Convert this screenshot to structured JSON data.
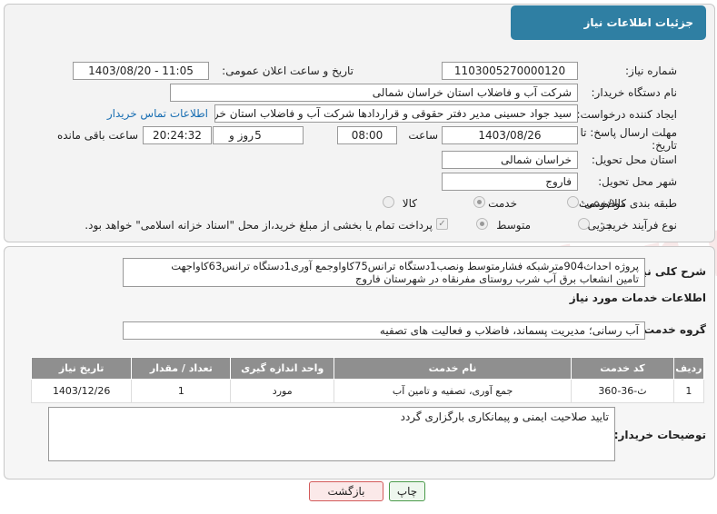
{
  "header": {
    "title": "جزئیات اطلاعات نیاز"
  },
  "form": {
    "need_number_label": "شماره نیاز:",
    "need_number": "1103005270000120",
    "announce_label": "تاریخ و ساعت اعلان عمومی:",
    "announce_value": "1403/08/20 - 11:05",
    "buyer_org_label": "نام دستگاه خریدار:",
    "buyer_org": "شرکت آب و فاضلاب استان خراسان شمالی",
    "creator_label": "ایجاد کننده درخواست:",
    "creator": "سید جواد حسینی مدیر دفتر حقوقی و قراردادها  شرکت آب و فاضلاب استان خراسان شمالی",
    "contact_link": "اطلاعات تماس خریدار",
    "deadline_label_1": "مهلت ارسال پاسخ: تا",
    "deadline_label_2": "تاریخ:",
    "deadline_date": "1403/08/26",
    "time_label": "ساعت",
    "deadline_time": "08:00",
    "days_value": "5",
    "days_label": "روز و",
    "remaining_time": "20:24:32",
    "remaining_label": "ساعت باقی مانده",
    "province_label": "استان محل تحویل:",
    "province": "خراسان شمالی",
    "city_label": "شهر محل تحویل:",
    "city": "فاروج",
    "category_label": "طبقه بندی موضوعی:",
    "category_options": [
      "کالا",
      "خدمت",
      "کالا/خدمت"
    ],
    "category_selected": "خدمت",
    "process_label": "نوع فرآیند خرید :",
    "process_options": [
      "جزیی",
      "متوسط"
    ],
    "process_selected": "متوسط",
    "payment_note": "پرداخت تمام یا بخشی از مبلغ خرید،از محل \"اسناد خزانه اسلامی\" خواهد بود."
  },
  "description": {
    "label": "شرح کلی نیاز:",
    "text_line1": "پروژه احداث904مترشبکه فشارمتوسط ونصب1دستگاه ترانس75کاواوجمع آوری1دستگاه ترانس63کاواجهت",
    "text_line2": "تامین انشعاب برق آب شرب روستای مفرنقاه در شهرستان فاروج"
  },
  "services": {
    "section_title": "اطلاعات خدمات مورد نیاز",
    "group_label": "گروه خدمت:",
    "group_value": "آب رسانی؛ مدیریت پسماند، فاضلاب و فعالیت های تصفیه",
    "columns": [
      "ردیف",
      "کد خدمت",
      "نام خدمت",
      "واحد اندازه گیری",
      "تعداد / مقدار",
      "تاریخ نیاز"
    ],
    "rows": [
      {
        "row": "1",
        "code": "ث-36-360",
        "name": "جمع آوری، تصفیه و تامین آب",
        "unit": "مورد",
        "qty": "1",
        "date": "1403/12/26"
      }
    ]
  },
  "buyer_notes": {
    "label": "توضیحات خریدار:",
    "text": "تایید صلاحیت ایمنی و پیمانکاری بارگزاری گردد"
  },
  "buttons": {
    "print": "چاپ",
    "back": "بازگشت"
  },
  "watermark": "AriaTender.neT",
  "colors": {
    "header": "#2f7fa3",
    "link": "#1a6fb3",
    "table_header": "#8f8f8f"
  }
}
